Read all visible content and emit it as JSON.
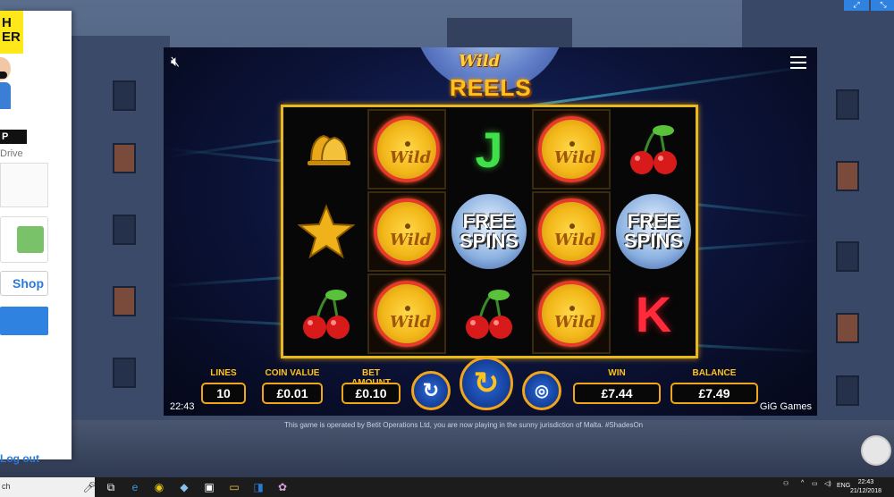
{
  "sidebar": {
    "logo_text": "H\nER",
    "username": "P",
    "subtitle": "Drive",
    "shop_label": "Shop",
    "logout_label": "Log out"
  },
  "game": {
    "title_wild": "Wild",
    "title_reels": "REELS",
    "grid": [
      [
        "bell",
        "wild",
        "j",
        "wild",
        "cherries"
      ],
      [
        "star",
        "wild",
        "free-spins",
        "wild",
        "free-spins"
      ],
      [
        "cherries",
        "wild",
        "cherries",
        "wild",
        "k"
      ]
    ],
    "symbols": {
      "wild": "Wild",
      "j": "J",
      "k": "K",
      "free": "FREE",
      "spins": "SPINS"
    },
    "controls": {
      "lines_label": "LINES",
      "lines_value": "10",
      "coin_label": "COIN VALUE",
      "coin_value": "£0.01",
      "bet_label": "BET AMOUNT",
      "bet_value": "£0.10",
      "win_label": "WIN",
      "win_value": "£7.44",
      "balance_label": "BALANCE",
      "balance_value": "£7.49"
    },
    "clock": "22:43",
    "provider": "GiG Games",
    "notice": "This game is operated by Betit Operations Ltd, you are now playing in the sunny jurisdiction of Malta. #ShadesOn"
  },
  "taskbar": {
    "search_text": "ch",
    "language": "ENG",
    "time": "22:43",
    "date": "21/12/2018"
  },
  "colors": {
    "accent_gold": "#f0a51a",
    "reel_frame": "#e8b820",
    "spin_blue": "#2a6ad8"
  }
}
